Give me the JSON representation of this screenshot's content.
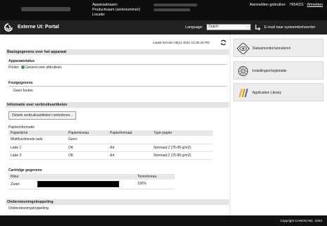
{
  "header": {
    "device_name_label": "Apparaatnaam:",
    "product_name_label": "Productnaam (serienummer):",
    "location_label": "Locatie:",
    "login_label": "Aanmelden gebruiker:",
    "login_user": "7654321",
    "logout_label": "Afmelden"
  },
  "nav": {
    "portal_title": "Externe UI: Portal",
    "language_label": "Language:",
    "language_value": "Dutch",
    "mail_link": "E-mail naar systeembeheerder"
  },
  "main": {
    "updated_text": "Laatst herzien 05/11 2022 12:39:15 PM",
    "basic_section": {
      "title": "Basisgegevens over het apparaat",
      "status_title": "Apparaatstatus",
      "printer_label": "Printer:",
      "printer_status": "Gereed voor afdrukken.",
      "error_title": "Foutgegevens",
      "error_value": "Geen fouten."
    },
    "consumables_section": {
      "title": "Informatie over verbruiksartikelen",
      "check_button": "Details verbruiksartikelen controleren...",
      "paper_title": "Papierinformatie",
      "paper_headers": [
        "Papierbron",
        "Papierniveau",
        "Papierformaat",
        "Type papier"
      ],
      "paper_rows": [
        [
          "Multifunctionele lade",
          "Geen",
          "",
          ""
        ],
        [
          "Lade 1",
          "OK",
          "A4",
          "Normaal 2 (75-89 g/m2)"
        ],
        [
          "Lade 2",
          "OK",
          "A4",
          "Normaal 2 (75-89 g/m2)"
        ]
      ],
      "cartridge_title": "Cartridge gegevens",
      "cartridge_headers": [
        "Kleur",
        "Tonerniveau"
      ],
      "cartridge_rows": [
        {
          "color": "Zwart",
          "level": "100%"
        }
      ]
    },
    "support_section": {
      "title": "Ondersteuningskoppeling",
      "label": "Ondersteuningskoppeling:"
    }
  },
  "side": {
    "status_monitor": "Statusmonitor/annuleren",
    "settings": "Instellingen/registratie",
    "app_library": "Application Library"
  },
  "footer": {
    "copyright": "Copyright CANON INC. 2023"
  },
  "colors": {
    "header_bg": "#0d0d0d",
    "nav_bg": "#222222",
    "status_ok": "#2fa34a",
    "panel_bg": "#ececec"
  }
}
